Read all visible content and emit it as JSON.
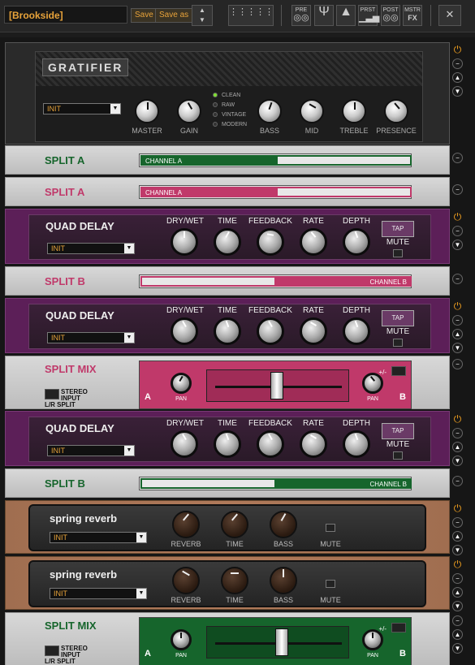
{
  "toolbar": {
    "preset_name": "[Brookside]",
    "save": "Save",
    "save_as": "Save as",
    "stepper_up": "▲",
    "stepper_down": "▼",
    "pre": "PRE",
    "prst": "PRST",
    "post": "POST",
    "mstr": "MSTR",
    "fx": "FX",
    "close": "✕"
  },
  "amp": {
    "name": "GRATIFIER",
    "preset": "INIT",
    "knobs": [
      "MASTER",
      "GAIN",
      "BASS",
      "MID",
      "TREBLE",
      "PRESENCE"
    ],
    "modes": [
      "CLEAN",
      "RAW",
      "VINTAGE",
      "MODERN"
    ]
  },
  "split_a_green": {
    "title": "SPLIT A",
    "channel": "CHANNEL A"
  },
  "split_a_pink": {
    "title": "SPLIT A",
    "channel": "CHANNEL A"
  },
  "delay1": {
    "name": "QUAD DELAY",
    "preset": "INIT",
    "labels": [
      "DRY/WET",
      "TIME",
      "FEEDBACK",
      "RATE",
      "DEPTH"
    ],
    "tap": "TAP",
    "mute": "MUTE"
  },
  "split_b_pink": {
    "title": "SPLIT B",
    "channel": "CHANNEL B"
  },
  "delay2": {
    "name": "QUAD DELAY",
    "preset": "INIT",
    "labels": [
      "DRY/WET",
      "TIME",
      "FEEDBACK",
      "RATE",
      "DEPTH"
    ],
    "tap": "TAP",
    "mute": "MUTE"
  },
  "mix_pink": {
    "title": "SPLIT MIX",
    "stereo_line1": "STEREO INPUT",
    "stereo_line2": "L/R SPLIT",
    "pan": "PAN",
    "a": "A",
    "b": "B",
    "plusminus": "+/-"
  },
  "delay3": {
    "name": "QUAD DELAY",
    "preset": "INIT",
    "labels": [
      "DRY/WET",
      "TIME",
      "FEEDBACK",
      "RATE",
      "DEPTH"
    ],
    "tap": "TAP",
    "mute": "MUTE"
  },
  "split_b_green": {
    "title": "SPLIT B",
    "channel": "CHANNEL B"
  },
  "reverb1": {
    "name": "spring reverb",
    "preset": "INIT",
    "labels": [
      "REVERB",
      "TIME",
      "BASS"
    ],
    "mute": "MUTE"
  },
  "reverb2": {
    "name": "spring reverb",
    "preset": "INIT",
    "labels": [
      "REVERB",
      "TIME",
      "BASS"
    ],
    "mute": "MUTE"
  },
  "mix_green": {
    "title": "SPLIT MIX",
    "stereo_line1": "STEREO INPUT",
    "stereo_line2": "L/R SPLIT",
    "pan": "PAN",
    "a": "A",
    "b": "B",
    "plusminus": "+/-"
  },
  "side": {
    "power": "⏻",
    "minus": "−",
    "up": "▲",
    "down": "▼"
  },
  "colors": {
    "green": "#16652c",
    "pink": "#c0396a",
    "delay": "#5c1f58",
    "accent": "#e8a33a"
  }
}
